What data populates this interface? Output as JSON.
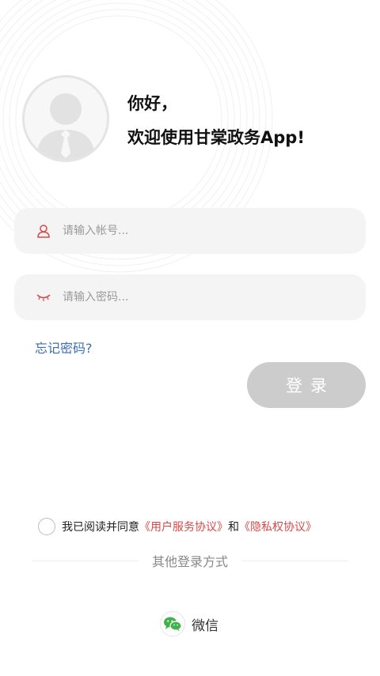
{
  "header": {
    "greeting": "你好，",
    "welcome": "欢迎使用甘棠政务App!"
  },
  "login": {
    "username_placeholder": "请输入帐号...",
    "password_placeholder": "请输入密码...",
    "forgot_label": "忘记密码?",
    "submit_label": "登录"
  },
  "agreement": {
    "prefix": "我已阅读并同意",
    "user_agreement": "《用户服务协议》",
    "conjunction": "和",
    "privacy_policy": "《隐私权协议》",
    "checked": false
  },
  "other_login": {
    "title": "其他登录方式",
    "wechat_label": "微信"
  },
  "icons": {
    "user": "user-icon",
    "password": "eye-closed-icon",
    "wechat": "wechat-icon",
    "avatar": "avatar-placeholder-icon"
  },
  "colors": {
    "accent_red": "#d64a4a",
    "link_blue": "#3d6db5",
    "button_disabled": "#cccccc",
    "wechat_green": "#3db34a"
  }
}
